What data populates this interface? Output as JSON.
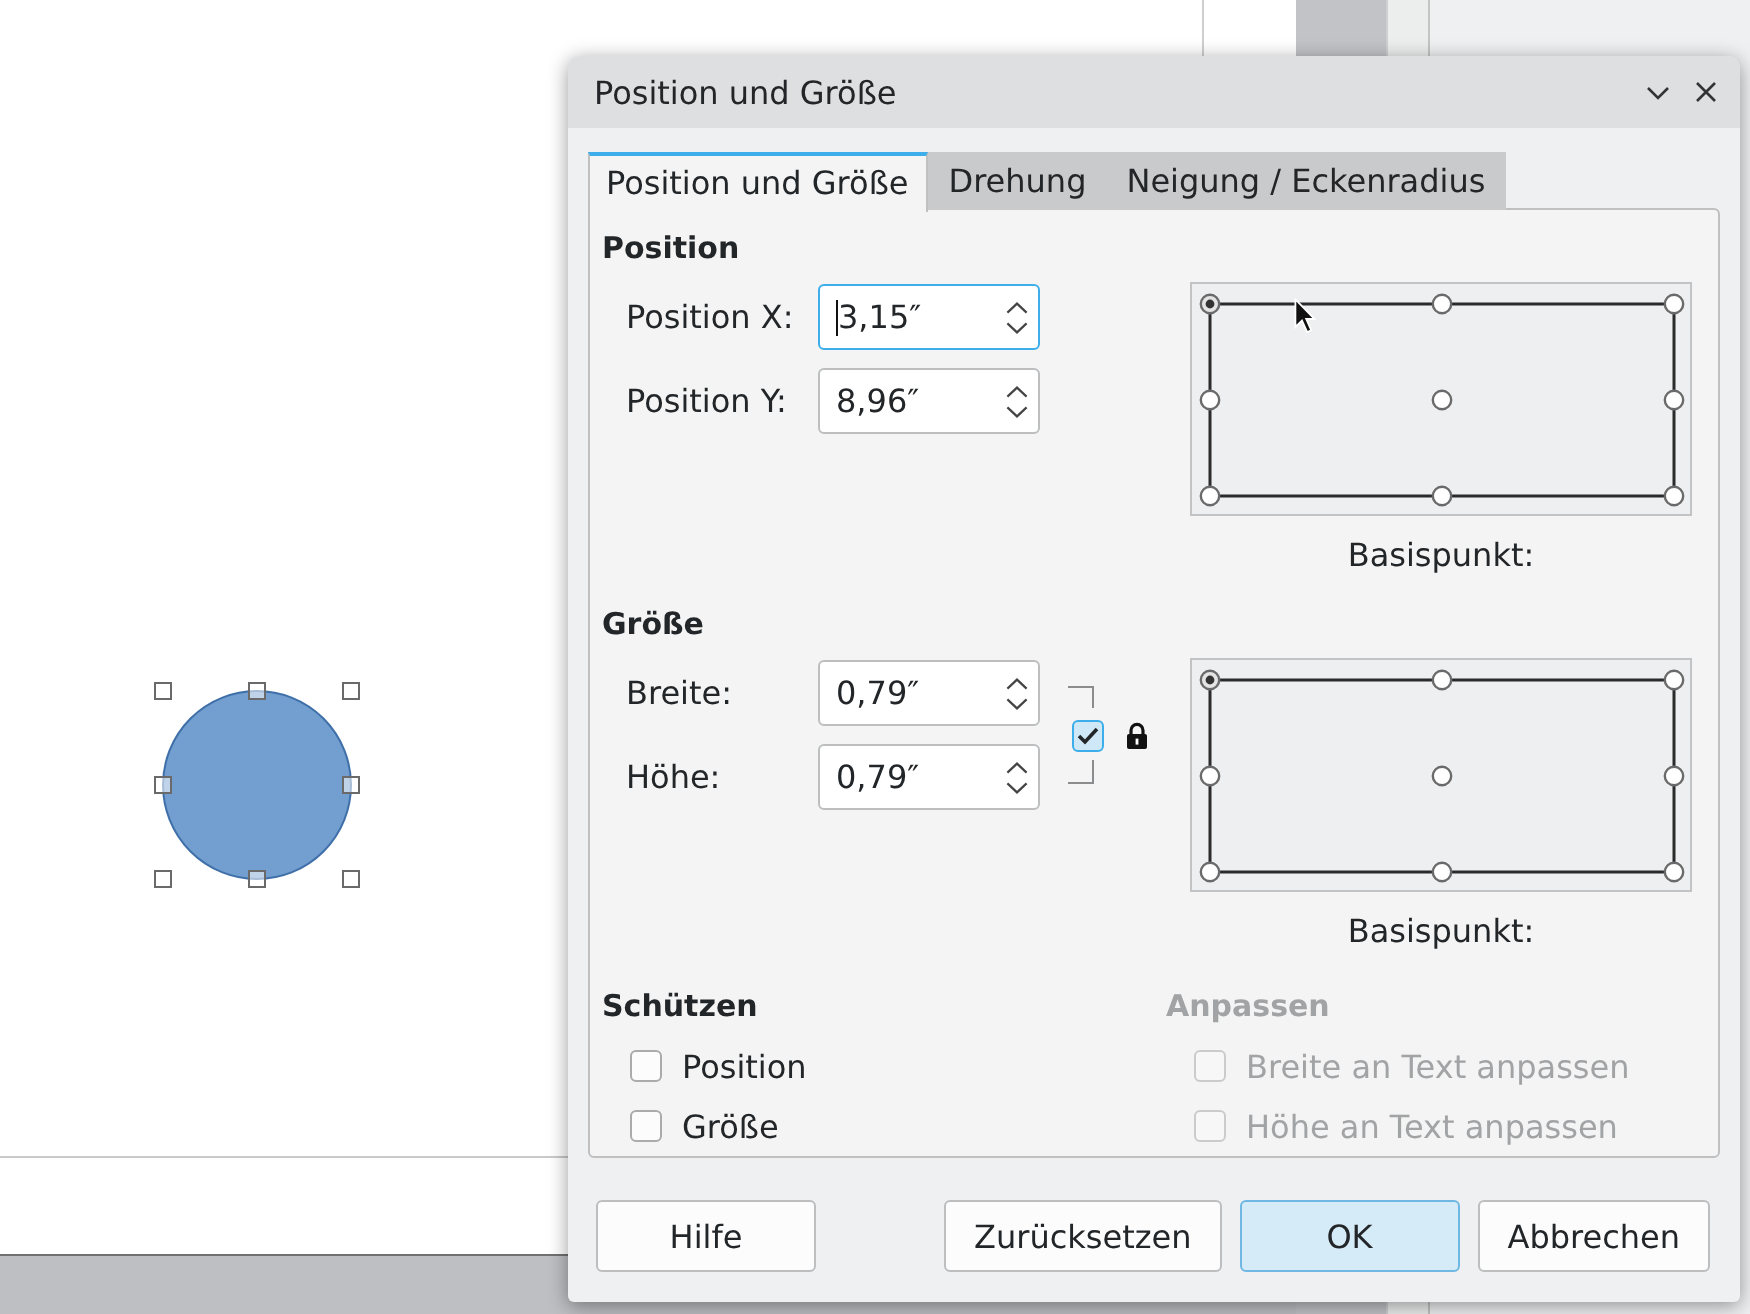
{
  "window": {
    "title": "Position und Größe"
  },
  "tabs": [
    {
      "label": "Position und Größe",
      "selected": true
    },
    {
      "label": "Drehung",
      "selected": false
    },
    {
      "label": "Neigung / Eckenradius",
      "selected": false
    }
  ],
  "position": {
    "heading": "Position",
    "fields": [
      {
        "label": "Position X:",
        "value": "3,15″",
        "focused": true
      },
      {
        "label": "Position Y:",
        "value": "8,96″",
        "focused": false
      }
    ],
    "base_point": {
      "label": "Basispunkt:",
      "points": [
        {
          "selected": true
        },
        {
          "selected": false
        },
        {
          "selected": false
        },
        {
          "selected": false
        },
        {
          "selected": false
        },
        {
          "selected": false
        },
        {
          "selected": false
        },
        {
          "selected": false
        },
        {
          "selected": false
        }
      ]
    }
  },
  "size": {
    "heading": "Größe",
    "fields": [
      {
        "label": "Breite:",
        "value": "0,79″",
        "focused": false
      },
      {
        "label": "Höhe:",
        "value": "0,79″",
        "focused": false
      }
    ],
    "keep_ratio": {
      "checked": true
    },
    "base_point": {
      "label": "Basispunkt:",
      "points": [
        {
          "selected": true
        },
        {
          "selected": false
        },
        {
          "selected": false
        },
        {
          "selected": false
        },
        {
          "selected": false
        },
        {
          "selected": false
        },
        {
          "selected": false
        },
        {
          "selected": false
        },
        {
          "selected": false
        }
      ]
    }
  },
  "protect": {
    "heading": "Schützen",
    "disabled": false,
    "options": [
      {
        "label": "Position",
        "checked": false,
        "disabled": false
      },
      {
        "label": "Größe",
        "checked": false,
        "disabled": false
      }
    ]
  },
  "adapt": {
    "heading": "Anpassen",
    "disabled": true,
    "options": [
      {
        "label": "Breite an Text anpassen",
        "checked": false,
        "disabled": true
      },
      {
        "label": "Höhe an Text anpassen",
        "checked": false,
        "disabled": true
      }
    ]
  },
  "buttons": [
    {
      "label": "Hilfe",
      "default": false
    },
    {
      "label": "Zurücksetzen",
      "default": false
    },
    {
      "label": "OK",
      "default": true
    },
    {
      "label": "Abbrechen",
      "default": false
    }
  ]
}
